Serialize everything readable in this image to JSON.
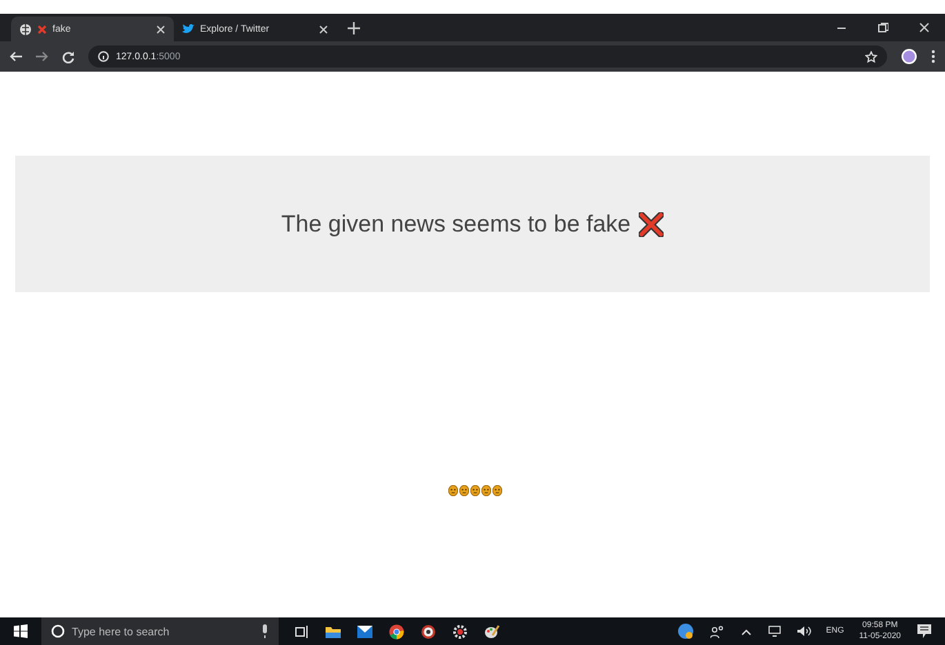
{
  "browser": {
    "tabs": [
      {
        "title": "fake",
        "kind": "result",
        "selected": true
      },
      {
        "title": "Explore / Twitter",
        "kind": "twitter",
        "selected": false
      }
    ],
    "address": {
      "host": "127.0.0.1",
      "port": ":5000"
    }
  },
  "result": {
    "message": "The given news seems to be fake",
    "kind": "cross"
  },
  "reactions": [
    {
      "kind": "face"
    },
    {
      "kind": "face"
    },
    {
      "kind": "face"
    },
    {
      "kind": "face"
    },
    {
      "kind": "face"
    }
  ],
  "taskbar": {
    "search_placeholder": "Type here to search",
    "language": "ENG",
    "time": "09:58 PM",
    "date": "11-05-2020"
  }
}
